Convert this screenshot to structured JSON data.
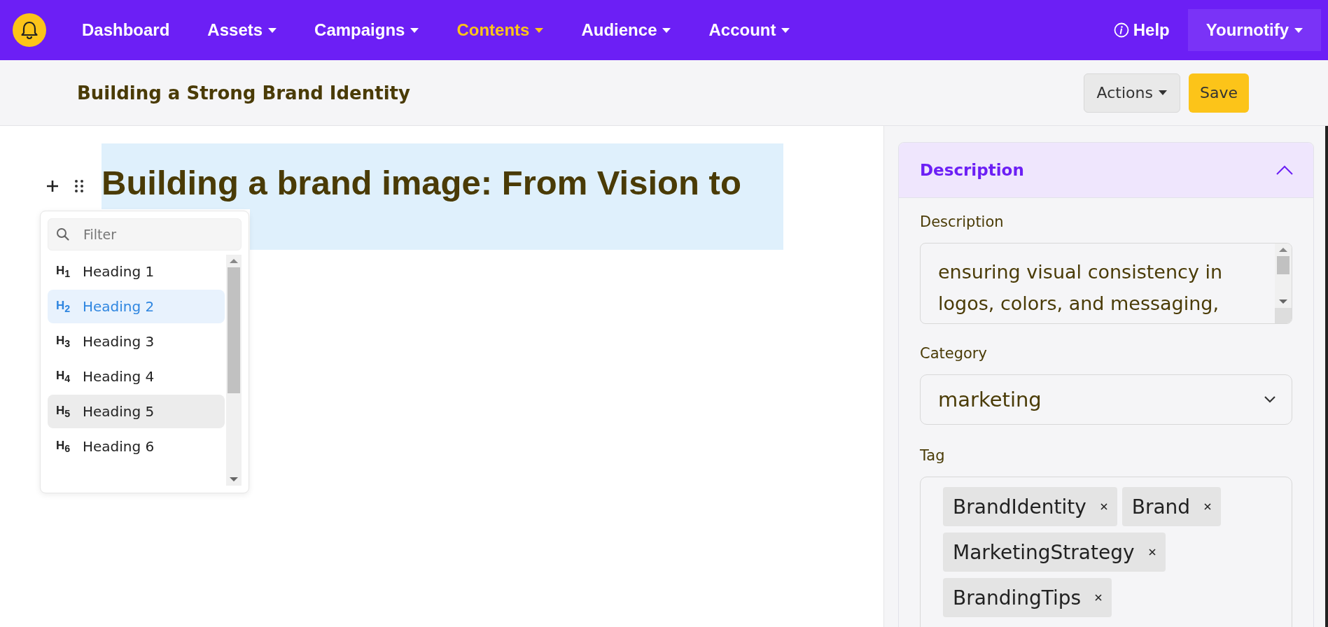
{
  "navbar": {
    "items": [
      {
        "label": "Dashboard",
        "has_caret": false,
        "selected": false
      },
      {
        "label": "Assets",
        "has_caret": true,
        "selected": false
      },
      {
        "label": "Campaigns",
        "has_caret": true,
        "selected": false
      },
      {
        "label": "Contents",
        "has_caret": true,
        "selected": true
      },
      {
        "label": "Audience",
        "has_caret": true,
        "selected": false
      },
      {
        "label": "Account",
        "has_caret": true,
        "selected": false
      }
    ],
    "help": "Help",
    "account": "Yournotify"
  },
  "page_header": {
    "title": "Building a Strong Brand Identity",
    "actions": "Actions",
    "save": "Save"
  },
  "editor": {
    "heading": "Building a brand image: From Vision to",
    "block_menu": {
      "filter_placeholder": "Filter",
      "items": [
        {
          "kind": "heading",
          "icon": "H$_{1}$",
          "label": "Heading 1",
          "selected": false,
          "hovered": false
        },
        {
          "kind": "heading",
          "icon": "H$_{2}$",
          "label": "Heading 2",
          "selected": true,
          "hovered": false
        },
        {
          "kind": "heading",
          "icon": "H$_{3}$",
          "label": "Heading 3",
          "selected": false,
          "hovered": false
        },
        {
          "kind": "heading",
          "icon": "H$_{4}$",
          "label": "Heading 4",
          "selected": false,
          "hovered": false
        },
        {
          "kind": "heading",
          "icon": "H$_{5}$",
          "label": "Heading 5",
          "selected": false,
          "hovered": true
        },
        {
          "kind": "heading",
          "icon": "H$_{6}$",
          "label": "Heading 6",
          "selected": false,
          "hovered": false
        }
      ]
    }
  },
  "sidebar": {
    "panel_title": "Description",
    "expanded": true,
    "description_label": "Description",
    "description_value": "ensuring visual consistency in logos, colors, and messaging,",
    "category_label": "Category",
    "category_value": "marketing",
    "tag_label": "Tag",
    "tags": [
      "BrandIdentity",
      "Brand",
      "MarketingStrategy",
      "BrandingTips"
    ]
  }
}
